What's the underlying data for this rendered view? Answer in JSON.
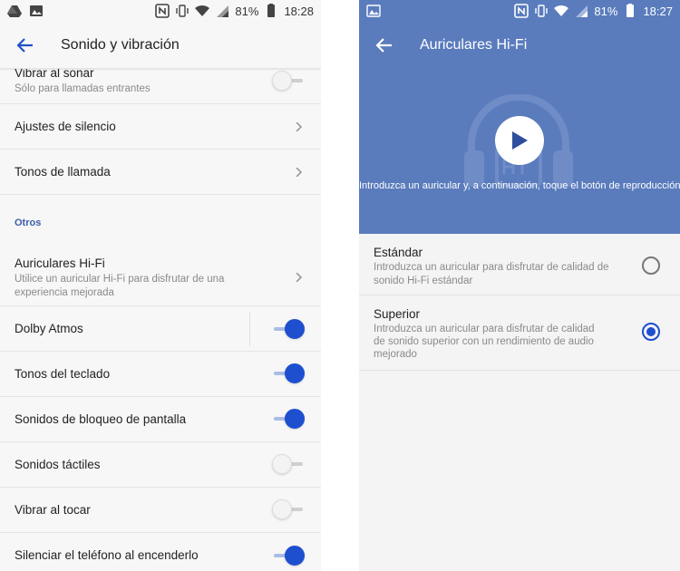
{
  "colors": {
    "accent": "#1e4fcf",
    "header_blue": "#5a7cbd",
    "section_blue": "#3b5ea8",
    "secondary_text": "#8a8a8a"
  },
  "left": {
    "status": {
      "battery": "81%",
      "time": "18:28"
    },
    "title": "Sonido y vibración",
    "rows": {
      "vibrar_sonar": {
        "label": "Vibrar al sonar",
        "sub": "Sólo para llamadas entrantes",
        "toggle": "off"
      },
      "ajustes_silencio": {
        "label": "Ajustes de silencio"
      },
      "tonos_llamada": {
        "label": "Tonos de llamada"
      },
      "section_otros": "Otros",
      "hifi": {
        "label": "Auriculares Hi-Fi",
        "sub1": "Utilice un auricular Hi-Fi para disfrutar de una",
        "sub2": "experiencia mejorada"
      },
      "dolby": {
        "label": "Dolby Atmos",
        "toggle": "on"
      },
      "tonos_teclado": {
        "label": "Tonos del teclado",
        "toggle": "on"
      },
      "bloqueo": {
        "label": "Sonidos de bloqueo de pantalla",
        "toggle": "on"
      },
      "tactiles": {
        "label": "Sonidos táctiles",
        "toggle": "off"
      },
      "vibrar_tocar": {
        "label": "Vibrar al tocar",
        "toggle": "off"
      },
      "silenciar": {
        "label": "Silenciar el teléfono al encenderlo",
        "toggle": "on"
      }
    }
  },
  "right": {
    "status": {
      "battery": "81%",
      "time": "18:27"
    },
    "title": "Auriculares Hi-Fi",
    "hint": "Introduzca un auricular y, a continuación, toque el botón de reproducción",
    "options": {
      "estandar": {
        "label": "Estándar",
        "sub1": "Introduzca un auricular para disfrutar de calidad de",
        "sub2": "sonido Hi-Fi estándar",
        "selected": false
      },
      "superior": {
        "label": "Superior",
        "sub1": "Introduzca un auricular para disfrutar de calidad",
        "sub2": "de sonido superior con un rendimiento de audio",
        "sub3": "mejorado",
        "selected": true
      }
    }
  }
}
